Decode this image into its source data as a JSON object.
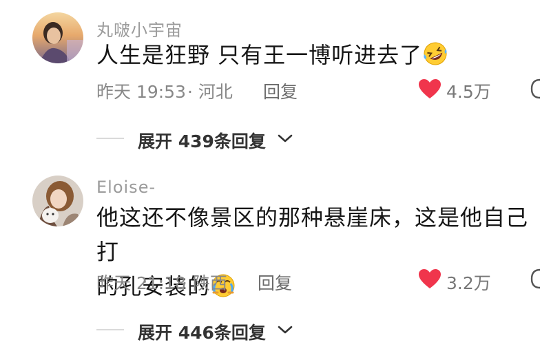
{
  "comments": [
    {
      "username": "丸啵小宇宙",
      "text_line1": "人生是狂野 只有王一博听进去了",
      "text_line2": "",
      "emoji": "rolling-on-floor-laughing-emoji",
      "time": "昨天 19:53",
      "location": "· 河北",
      "reply_label": "回复",
      "likes": "4.5万",
      "expand": {
        "prefix": "展开",
        "count": "439",
        "suffix": "条回复"
      }
    },
    {
      "username": "Eloise-",
      "text_line1": "他这还不像景区的那种悬崖床，这是他自己打",
      "text_line2": "的孔安装的",
      "emoji": "crying-laughing-face-emoji",
      "time": "昨天 21:18",
      "location": "· 陕西",
      "reply_label": "回复",
      "likes": "3.2万",
      "expand": {
        "prefix": "展开",
        "count": "446",
        "suffix": "条回复"
      }
    }
  ],
  "colors": {
    "heart": "#f0354c",
    "meta": "#888888",
    "username": "#9b9b9b",
    "text": "#161616"
  },
  "icons": {
    "like": "heart-icon",
    "expand": "chevron-down-icon",
    "edge": "comment-bubble-icon"
  }
}
